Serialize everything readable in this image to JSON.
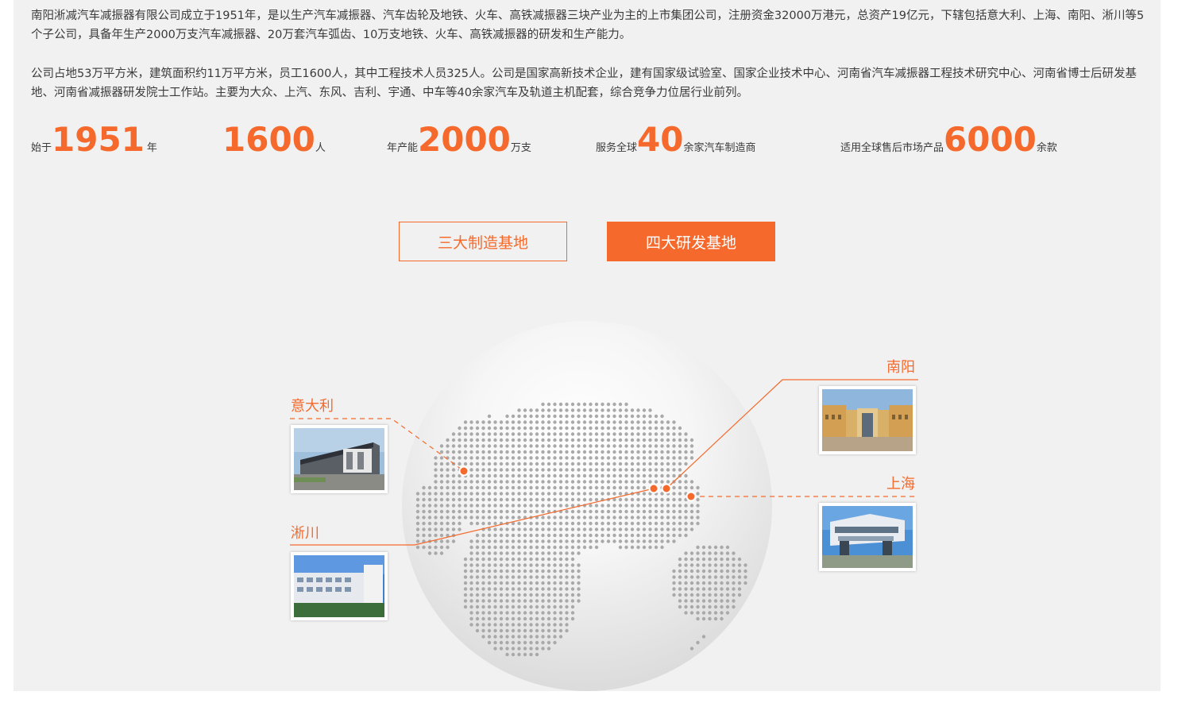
{
  "intro": {
    "paragraph1": "南阳淅减汽车减振器有限公司成立于1951年，是以生产汽车减振器、汽车齿轮及地铁、火车、高铁减振器三块产业为主的上市集团公司，注册资金32000万港元，总资产19亿元，下辖包括意大利、上海、南阳、淅川等5个子公司，具备年生产2000万支汽车减振器、20万套汽车弧齿、10万支地铁、火车、高铁减振器的研发和生产能力。",
    "paragraph2": "公司占地53万平方米，建筑面积约11万平方米，员工1600人，其中工程技术人员325人。公司是国家高新技术企业，建有国家级试验室、国家企业技术中心、河南省汽车减振器工程技术研究中心、河南省博士后研发基地、河南省减振器研发院士工作站。主要为大众、上汽、东风、吉利、宇通、中车等40余家汽车及轨道主机配套，综合竞争力位居行业前列。"
  },
  "stats": [
    {
      "prefix": "始于",
      "number": "1951",
      "suffix": "年"
    },
    {
      "prefix": "",
      "number": "1600",
      "suffix": "人"
    },
    {
      "prefix": "年产能",
      "number": "2000",
      "suffix": "万支"
    },
    {
      "prefix": "服务全球",
      "number": "40",
      "suffix": "余家汽车制造商"
    },
    {
      "prefix": "适用全球售后市场产品",
      "number": "6000",
      "suffix": "余款"
    }
  ],
  "tabs": {
    "manufacturing": "三大制造基地",
    "research": "四大研发基地"
  },
  "locations": {
    "italy": "意大利",
    "xichuan": "淅川",
    "nanyang": "南阳",
    "shanghai": "上海"
  },
  "colors": {
    "accent": "#f56a2c",
    "text": "#3a3a3a",
    "panel": "#f1f1f1"
  }
}
